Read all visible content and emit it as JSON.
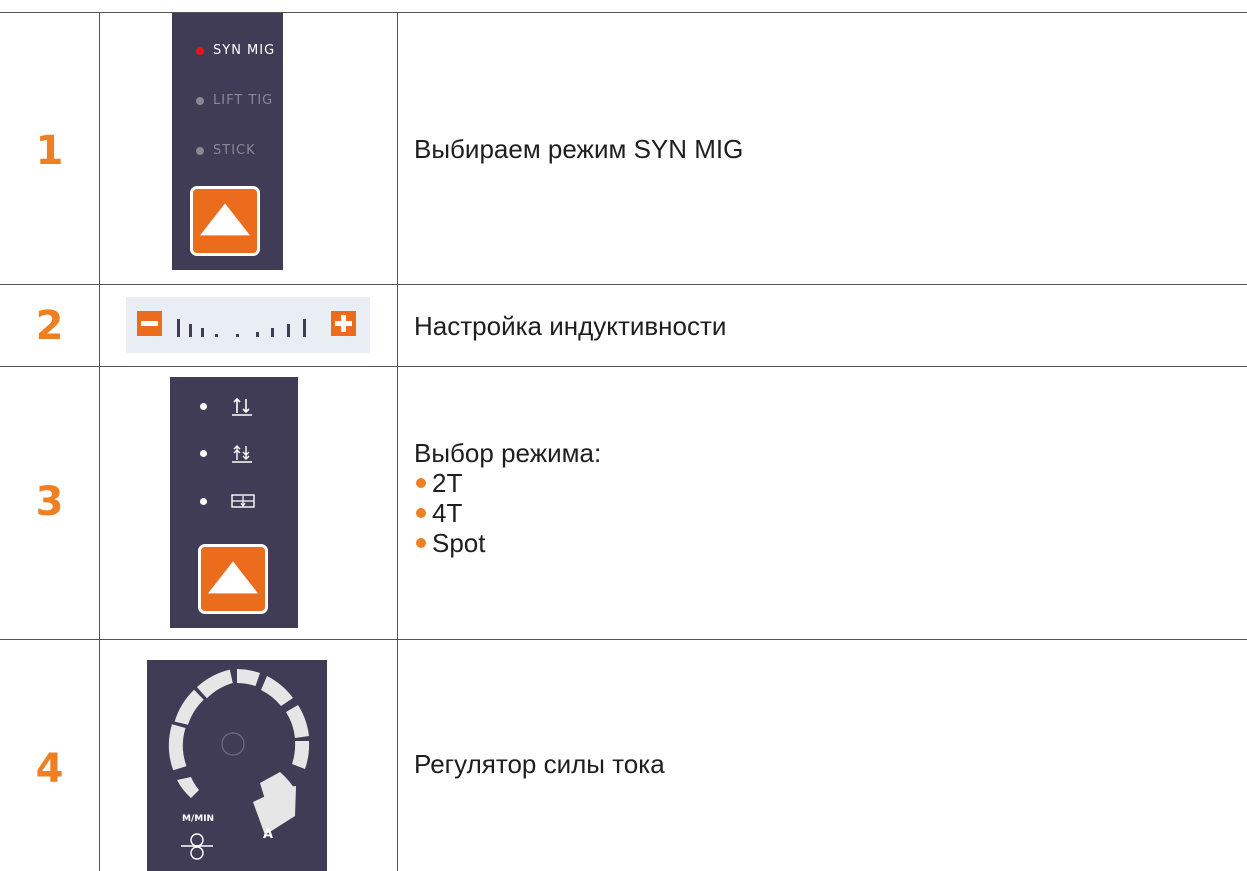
{
  "rows": [
    {
      "number": "1",
      "description": "Выбираем режим SYN MIG",
      "panel": {
        "modes": [
          {
            "label": "SYN MIG",
            "active": true
          },
          {
            "label": "LIFT TIG",
            "active": false
          },
          {
            "label": "STICK",
            "active": false
          }
        ],
        "button_icon": "up-arrow-icon"
      }
    },
    {
      "number": "2",
      "description": "Настройка индуктивности",
      "panel": {
        "minus_icon": "minus-icon",
        "plus_icon": "plus-icon"
      }
    },
    {
      "number": "3",
      "description": "Выбор режима:",
      "options": [
        "2T",
        "4T",
        "Spot"
      ],
      "panel": {
        "mode_icons": [
          "2t-mode-icon",
          "4t-mode-icon",
          "spot-mode-icon"
        ],
        "button_icon": "up-arrow-icon"
      }
    },
    {
      "number": "4",
      "description": "Регулятор силы тока",
      "panel": {
        "left_label": "M/MIN",
        "right_label": "A",
        "knob_icon": "knob-icon",
        "wire_feed_icon": "wire-feed-icon"
      }
    }
  ],
  "colors": {
    "accent": "#ee7f22",
    "panel": "#413c55",
    "button": "#ec6c1e",
    "led_active": "#e8141b",
    "led_inactive": "#8a8697",
    "segment": "#e6e6e6"
  }
}
